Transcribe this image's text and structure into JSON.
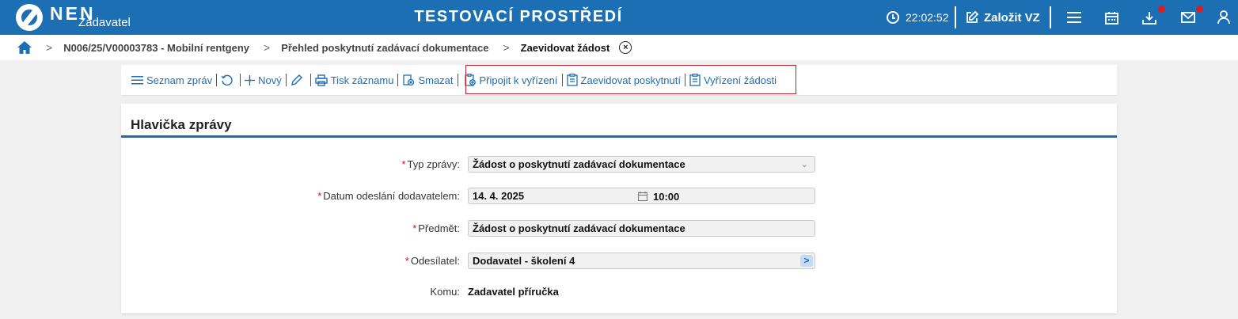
{
  "header": {
    "logo_text": "NEN",
    "logo_sub": "Zadavatel",
    "env_title": "TESTOVACÍ PROSTŘEDÍ",
    "time": "22:02:52",
    "create_label": "Založit VZ",
    "icons": [
      "clock-icon",
      "edit-icon",
      "menu-icon",
      "calendar-icon",
      "download-icon",
      "mail-icon",
      "user-icon"
    ],
    "badge_color": "#d82020",
    "bar_color": "#1c6fb3"
  },
  "breadcrumb": {
    "items": [
      "N006/25/V00003783 - Mobilní rentgeny",
      "Přehled poskytnutí zadávací dokumentace",
      "Zaevidovat žádost"
    ],
    "close_symbol": "×"
  },
  "toolbar": {
    "list_label": "Seznam zpráv",
    "new_label": "Nový",
    "print_label": "Tisk záznamu",
    "delete_label": "Smazat",
    "attach_label": "Připojit k vyřízení",
    "register_label": "Zaevidovat poskytnutí",
    "resolve_label": "Vyřízení žádosti",
    "highlight_color": "#c0202f"
  },
  "panel": {
    "title": "Hlavička zprávy",
    "fields": {
      "type": {
        "label": "Typ zprávy:",
        "value": "Žádost o poskytnutí zadávací dokumentace",
        "required": "*"
      },
      "date": {
        "label": "Datum odeslání dodavatelem:",
        "date": "14. 4. 2025",
        "time": "10:00",
        "required": "*"
      },
      "subject": {
        "label": "Předmět:",
        "value": "Žádost o poskytnutí zadávací dokumentace",
        "required": "*"
      },
      "sender": {
        "label": "Odesílatel:",
        "value": "Dodavatel - školení 4",
        "required": "*"
      },
      "recipient": {
        "label": "Komu:",
        "value": "Zadavatel příručka"
      }
    }
  }
}
